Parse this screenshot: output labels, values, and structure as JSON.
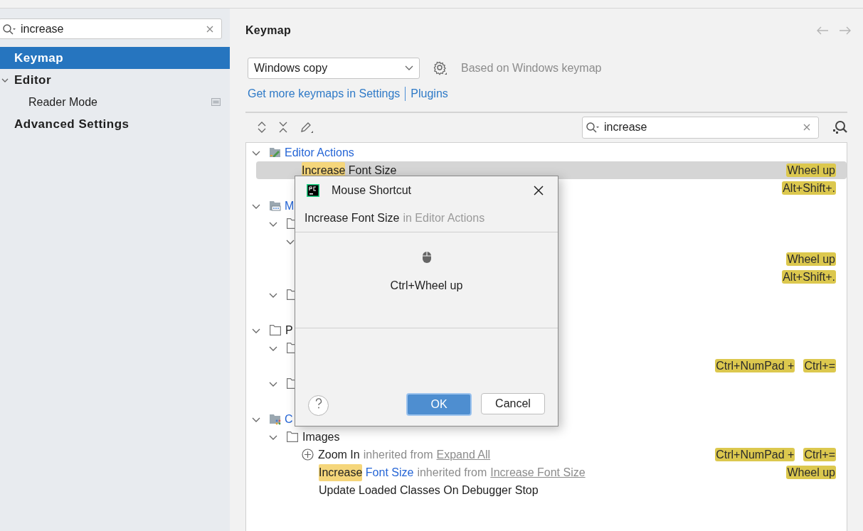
{
  "sidebar": {
    "search": {
      "value": "increase"
    },
    "items": [
      {
        "kind": "section",
        "label": "Keymap",
        "selected": true
      },
      {
        "kind": "section",
        "label": "Editor",
        "selected": false,
        "expanded": true,
        "children": [
          {
            "kind": "page",
            "label": "Reader Mode",
            "selected": false,
            "project_level": true
          }
        ]
      },
      {
        "kind": "section",
        "label": "Advanced Settings",
        "selected": false
      }
    ]
  },
  "main": {
    "title": "Keymap",
    "keymap_select": {
      "value": "Windows copy"
    },
    "based_on": "Based on Windows keymap",
    "links": [
      "Get more keymaps in Settings",
      "Plugins"
    ],
    "search": {
      "value": "increase"
    },
    "tree": [
      {
        "kind": "category",
        "expanded": true,
        "modified": true,
        "label": [
          {
            "text": "Editor Actions"
          }
        ],
        "children": [
          {
            "kind": "action",
            "selected": true,
            "label": [
              {
                "text": "Increase",
                "match": true
              },
              {
                "text": " Font Size"
              }
            ],
            "shortcuts": [
              "Wheel up"
            ]
          },
          {
            "kind": "action",
            "selected": false,
            "shortcuts": [
              "Alt+Shift+."
            ]
          }
        ]
      },
      {
        "kind": "category",
        "expanded": true,
        "modified": true,
        "label": [
          {
            "text": "M"
          }
        ],
        "children": [
          {
            "kind": "folder",
            "expanded": true,
            "children": [
              {
                "kind": "folder",
                "expanded": true,
                "children": [
                  {
                    "kind": "action",
                    "selected": false,
                    "shortcuts": [
                      "Wheel up"
                    ]
                  },
                  {
                    "kind": "action",
                    "selected": false,
                    "shortcuts": [
                      "Alt+Shift+."
                    ]
                  }
                ]
              }
            ]
          },
          {
            "kind": "folder",
            "expanded": true,
            "children": [
              {
                "kind": "action",
                "selected": false
              }
            ]
          }
        ]
      },
      {
        "kind": "category",
        "expanded": true,
        "modified": false,
        "label": [
          {
            "text": "P"
          }
        ],
        "children": [
          {
            "kind": "folder",
            "expanded": true,
            "children": [
              {
                "kind": "action",
                "selected": false,
                "shortcuts": [
                  "Ctrl+NumPad +",
                  "Ctrl+="
                ]
              }
            ]
          },
          {
            "kind": "folder",
            "expanded": true,
            "children": [
              {
                "kind": "action",
                "selected": false
              }
            ]
          }
        ]
      },
      {
        "kind": "category",
        "expanded": true,
        "modified": true,
        "label": [
          {
            "text": "C"
          }
        ],
        "children": [
          {
            "kind": "folder",
            "expanded": true,
            "modified": false,
            "label": [
              {
                "text": "Images"
              }
            ],
            "children": [
              {
                "kind": "iconaction",
                "selected": false,
                "modified": false,
                "label": [
                  {
                    "text": "Zoom In"
                  }
                ],
                "note": "inherited from",
                "link": "Expand All",
                "shortcuts": [
                  "Ctrl+NumPad +",
                  "Ctrl+="
                ]
              },
              {
                "kind": "action",
                "selected": false,
                "modified": true,
                "label": [
                  {
                    "text": "Increase",
                    "match": true
                  },
                  {
                    "text": " Font Size"
                  }
                ],
                "note": "inherited from",
                "link": "Increase Font Size",
                "shortcuts": [
                  "Wheel up"
                ]
              },
              {
                "kind": "action",
                "selected": false,
                "modified": false,
                "label": [
                  {
                    "text": "Update Loaded Classes On Debugger Stop"
                  }
                ]
              }
            ]
          }
        ]
      }
    ]
  },
  "dialog": {
    "title": "Mouse Shortcut",
    "action": "Increase Font Size",
    "context": "in Editor Actions",
    "shortcut": "Ctrl+Wheel up",
    "buttons": [
      {
        "label": "OK",
        "default": true
      },
      {
        "label": "Cancel",
        "default": false
      }
    ]
  }
}
